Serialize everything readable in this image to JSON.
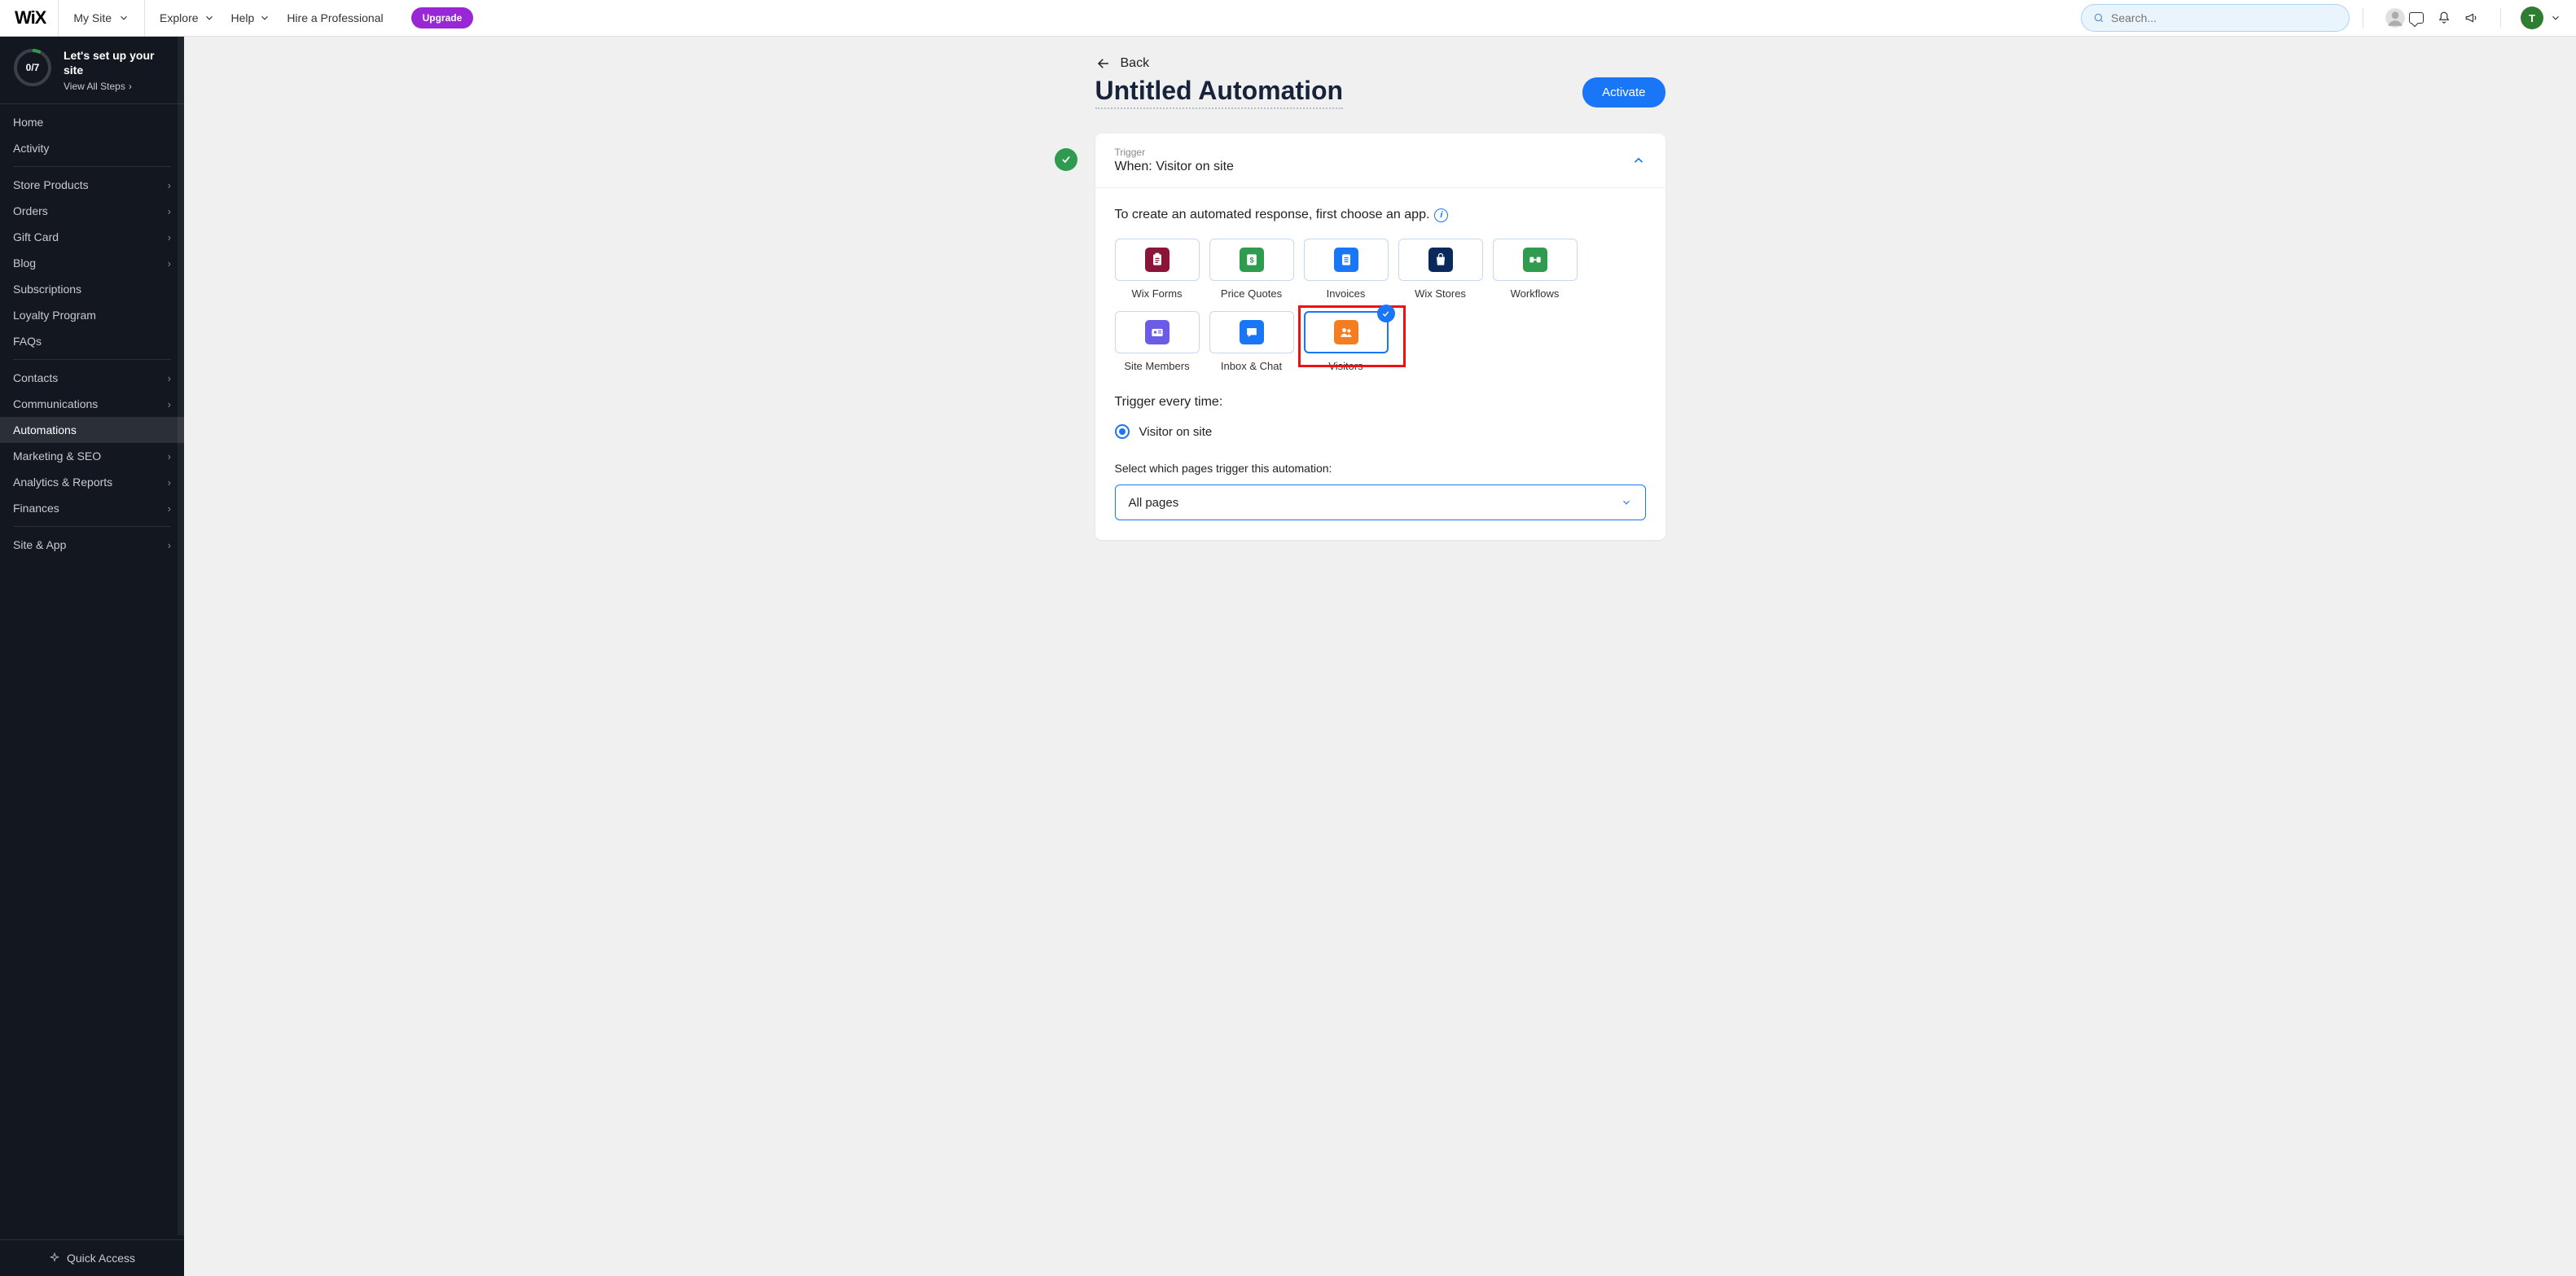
{
  "topbar": {
    "logo": "WiX",
    "site_name": "My Site",
    "nav": {
      "explore": "Explore",
      "help": "Help",
      "hire": "Hire a Professional"
    },
    "upgrade": "Upgrade",
    "search_placeholder": "Search...",
    "avatar_initial": "T"
  },
  "sidebar": {
    "progress": {
      "value": "0/7",
      "title": "Let's set up your site",
      "link": "View All Steps"
    },
    "groups": [
      {
        "items": [
          {
            "label": "Home",
            "chevron": false
          },
          {
            "label": "Activity",
            "chevron": false
          }
        ]
      },
      {
        "items": [
          {
            "label": "Store Products",
            "chevron": true
          },
          {
            "label": "Orders",
            "chevron": true
          },
          {
            "label": "Gift Card",
            "chevron": true
          },
          {
            "label": "Blog",
            "chevron": true
          },
          {
            "label": "Subscriptions",
            "chevron": false
          },
          {
            "label": "Loyalty Program",
            "chevron": false
          },
          {
            "label": "FAQs",
            "chevron": false
          }
        ]
      },
      {
        "items": [
          {
            "label": "Contacts",
            "chevron": true
          },
          {
            "label": "Communications",
            "chevron": true
          },
          {
            "label": "Automations",
            "chevron": false,
            "active": true
          },
          {
            "label": "Marketing & SEO",
            "chevron": true
          },
          {
            "label": "Analytics & Reports",
            "chevron": true
          },
          {
            "label": "Finances",
            "chevron": true
          }
        ]
      },
      {
        "items": [
          {
            "label": "Site & App",
            "chevron": true
          }
        ]
      }
    ],
    "quick_access": "Quick Access"
  },
  "page": {
    "back": "Back",
    "title": "Untitled Automation",
    "activate": "Activate"
  },
  "trigger_card": {
    "label": "Trigger",
    "title": "When: Visitor on site",
    "instruction": "To create an automated response, first choose an app.",
    "apps": [
      {
        "name": "Wix Forms",
        "icon_bg": "#8b1538",
        "icon": "clipboard"
      },
      {
        "name": "Price Quotes",
        "icon_bg": "#2e9b4f",
        "icon": "dollar"
      },
      {
        "name": "Invoices",
        "icon_bg": "#1976f6",
        "icon": "doc"
      },
      {
        "name": "Wix Stores",
        "icon_bg": "#0b2a5c",
        "icon": "bag"
      },
      {
        "name": "Workflows",
        "icon_bg": "#2e9b4f",
        "icon": "flow"
      },
      {
        "name": "Site Members",
        "icon_bg": "#6b5ce6",
        "icon": "id"
      },
      {
        "name": "Inbox & Chat",
        "icon_bg": "#1976f6",
        "icon": "chat"
      },
      {
        "name": "Visitors",
        "icon_bg": "#f57c1f",
        "icon": "people",
        "selected": true,
        "highlighted": true
      }
    ],
    "trigger_heading": "Trigger every time:",
    "radio_option": "Visitor on site",
    "pages_label": "Select which pages trigger this automation:",
    "pages_value": "All pages"
  }
}
